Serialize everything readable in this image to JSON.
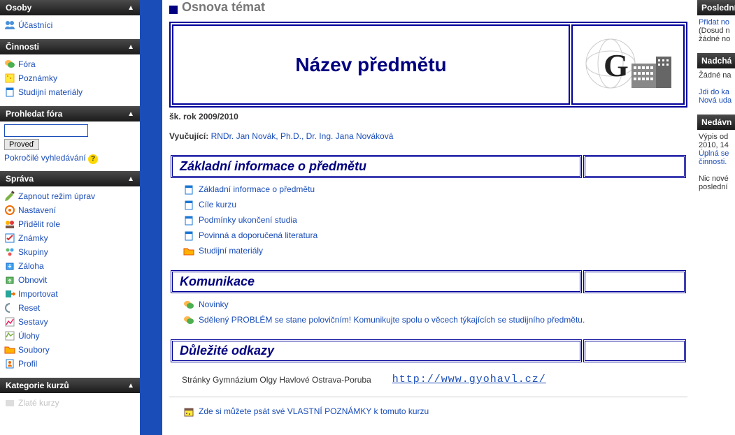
{
  "sidebar": {
    "osoby": {
      "title": "Osoby",
      "items": [
        {
          "label": "Účastníci"
        }
      ]
    },
    "cinnosti": {
      "title": "Činnosti",
      "items": [
        {
          "label": "Fóra"
        },
        {
          "label": "Poznámky"
        },
        {
          "label": "Studijní materiály"
        }
      ]
    },
    "search": {
      "title": "Prohledat fóra",
      "button": "Proveď",
      "advanced": "Pokročilé vyhledávání"
    },
    "sprava": {
      "title": "Správa",
      "items": [
        {
          "label": "Zapnout režim úprav"
        },
        {
          "label": "Nastavení"
        },
        {
          "label": "Přidělit role"
        },
        {
          "label": "Známky"
        },
        {
          "label": "Skupiny"
        },
        {
          "label": "Záloha"
        },
        {
          "label": "Obnovit"
        },
        {
          "label": "Importovat"
        },
        {
          "label": "Reset"
        },
        {
          "label": "Sestavy"
        },
        {
          "label": "Úlohy"
        },
        {
          "label": "Soubory"
        },
        {
          "label": "Profil"
        }
      ]
    },
    "kategorie": {
      "title": "Kategorie kurzů",
      "items": [
        {
          "label": "Zlaté kurzy"
        }
      ]
    }
  },
  "main": {
    "breadcrumb_title": "Osnova témat",
    "course_title": "Název předmětu",
    "school_year": "šk. rok 2009/2010",
    "teacher_label": "Vyučující:",
    "teachers": "RNDr. Jan Novák, Ph.D., Dr. Ing. Jana Nováková",
    "sections": [
      {
        "title": "Základní informace o předmětu",
        "activities": [
          {
            "type": "resource",
            "label": "Základní informace o předmětu"
          },
          {
            "type": "resource",
            "label": "Cíle kurzu"
          },
          {
            "type": "resource",
            "label": "Podmínky ukončení studia"
          },
          {
            "type": "resource",
            "label": "Povinná a doporučená literatura"
          },
          {
            "type": "folder",
            "label": "Studijní materiály"
          }
        ]
      },
      {
        "title": "Komunikace",
        "activities": [
          {
            "type": "forum",
            "label": "Novinky"
          },
          {
            "type": "forum",
            "label": "Sdělený PROBLÉM se stane polovičním! Komunikujte spolu o věcech týkajících se studijního předmětu."
          }
        ]
      },
      {
        "title": "Důležité odkazy"
      }
    ],
    "link_row": {
      "label": "Stránky Gymnázium Olgy Havlové Ostrava-Poruba",
      "url": "http://www.gyohavl.cz/"
    },
    "notes_link": "Zde si můžete psát své VLASTNÍ POZNÁMKY k tomuto kurzu"
  },
  "right": {
    "posledni": {
      "title": "Poslední",
      "link": "Přidat no",
      "text": "(Dosud n\nžádné no"
    },
    "nadcha": {
      "title": "Nadchá",
      "text": "Žádné na",
      "link1": "Jdi do ka",
      "link2": "Nová uda"
    },
    "nedavn": {
      "title": "Nedávn",
      "text1": "Výpis od\n2010, 14",
      "link": "Úplná se\nčinnosti.",
      "text2": "Nic nové\nposlední"
    }
  },
  "colors": {
    "primary": "#1a4db8",
    "navy": "#000080",
    "border": "#000099"
  }
}
